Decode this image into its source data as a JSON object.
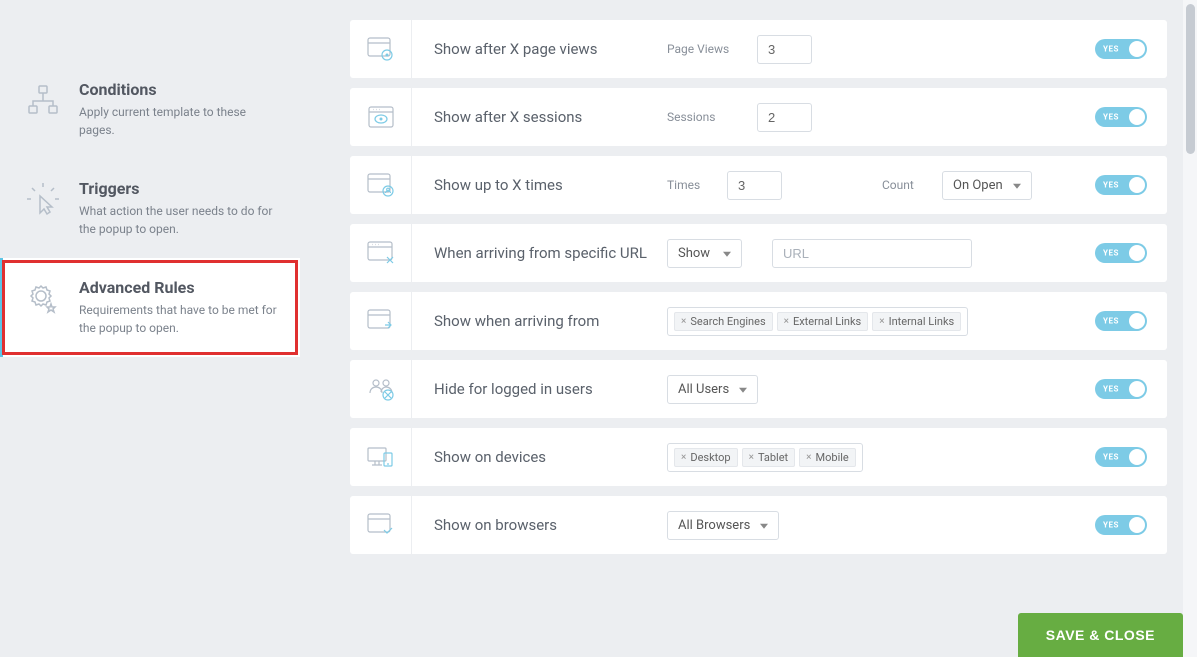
{
  "sidebar": {
    "items": [
      {
        "title": "Conditions",
        "desc": "Apply current template to these pages."
      },
      {
        "title": "Triggers",
        "desc": "What action the user needs to do for the popup to open."
      },
      {
        "title": "Advanced Rules",
        "desc": "Requirements that have to be met for the popup to open."
      }
    ]
  },
  "rules": {
    "page_views": {
      "title": "Show after X page views",
      "label": "Page Views",
      "value": "3"
    },
    "sessions": {
      "title": "Show after X sessions",
      "label": "Sessions",
      "value": "2"
    },
    "times": {
      "title": "Show up to X times",
      "label": "Times",
      "value": "3",
      "count_label": "Count",
      "count_select": "On Open"
    },
    "url": {
      "title": "When arriving from specific URL",
      "select": "Show",
      "placeholder": "URL"
    },
    "arriving": {
      "title": "Show when arriving from",
      "tags": [
        "Search Engines",
        "External Links",
        "Internal Links"
      ]
    },
    "hide_users": {
      "title": "Hide for logged in users",
      "select": "All Users"
    },
    "devices": {
      "title": "Show on devices",
      "tags": [
        "Desktop",
        "Tablet",
        "Mobile"
      ]
    },
    "browsers": {
      "title": "Show on browsers",
      "select": "All Browsers"
    }
  },
  "toggle_label": "YES",
  "save_button": "SAVE & CLOSE"
}
